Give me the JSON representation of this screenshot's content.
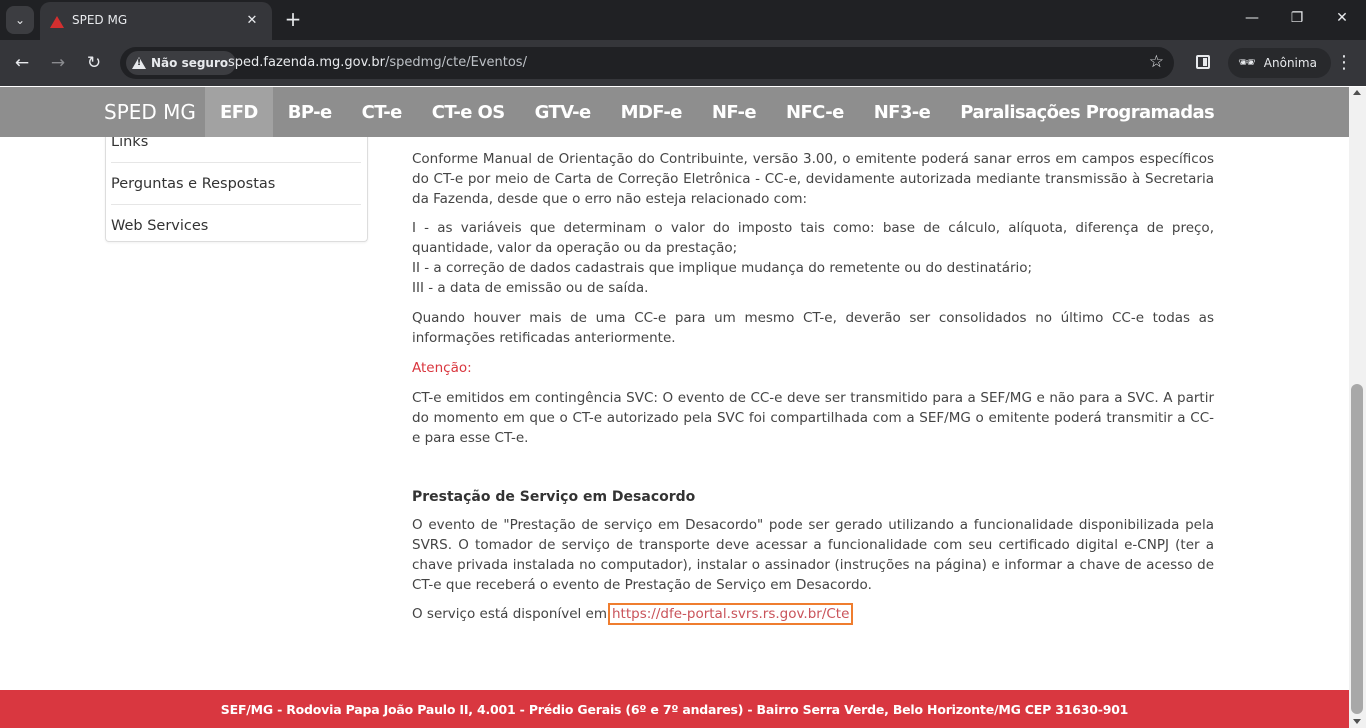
{
  "browser": {
    "tab_title": "SPED MG",
    "tab_close": "✕",
    "new_tab": "+",
    "tab_search": "⌄",
    "security_label": "Não seguro",
    "url_host": "sped.fazenda.mg.gov.br",
    "url_path": "/spedmg/cte/Eventos/",
    "profile_label": "Anônima",
    "minimize": "—",
    "restore": "❐",
    "close": "✕",
    "back": "←",
    "forward": "→",
    "reload": "↻",
    "star": "☆",
    "menu": "⋮",
    "incognito_icon": "🕶"
  },
  "site": {
    "brand": "SPED MG",
    "nav": [
      "EFD",
      "BP-e",
      "CT-e",
      "CT-e OS",
      "GTV-e",
      "MDF-e",
      "NF-e",
      "NFC-e",
      "NF3-e",
      "Paralisações Programadas"
    ],
    "active_nav": "EFD"
  },
  "sidebar": {
    "items": [
      "Links",
      "Perguntas e Respostas",
      "Web Services"
    ]
  },
  "content": {
    "p1": "Conforme Manual de Orientação do Contribuinte, versão 3.00, o emitente poderá sanar erros em campos específicos do CT-e por meio de Carta de Correção Eletrônica - CC-e, devidamente autorizada mediante transmissão à Secretaria da Fazenda, desde que o erro não esteja relacionado com:",
    "item1": "I - as variáveis que determinam o valor do imposto tais como: base de cálculo, alíquota, diferença de preço, quantidade, valor da operação ou da prestação;",
    "item2": "II - a correção de dados cadastrais que implique mudança do remetente ou do destinatário;",
    "item3": "III - a data de emissão ou de saída.",
    "p2": "Quando houver mais de uma CC-e para um mesmo CT-e, deverão ser consolidados no último CC-e todas as informações retificadas anteriormente.",
    "attention": "Atenção:",
    "p3": "CT-e emitidos em contingência SVC: O evento de CC-e deve ser transmitido para a SEF/MG e não para a SVC. A partir do momento em que o CT-e autorizado pela SVC foi compartilhada com a SEF/MG o emitente poderá transmitir a CC-e para esse CT-e.",
    "heading2": "Prestação de Serviço em Desacordo",
    "p4": "O evento de \"Prestação de serviço em Desacordo\" pode ser gerado utilizando a funcionalidade disponibilizada pela SVRS. O tomador de serviço de transporte deve acessar a funcionalidade com seu certificado digital e-CNPJ (ter a chave privada instalada no computador), instalar o assinador (instruções na página) e informar a chave de acesso de CT-e que receberá o evento de Prestação de Serviço em Desacordo.",
    "p5_prefix": "O serviço está disponível em",
    "link_text": "https://dfe-portal.svrs.rs.gov.br/Cte"
  },
  "footer": {
    "text": "SEF/MG - Rodovia Papa João Paulo II, 4.001 - Prédio Gerais (6º e 7º andares) - Bairro Serra Verde, Belo Horizonte/MG CEP 31630-901"
  },
  "colors": {
    "nav_bg": "#8e8e8e",
    "footer_bg": "#d93740",
    "attention": "#d9363e",
    "link": "#c9535a",
    "highlight_box": "#ef7d2f"
  }
}
